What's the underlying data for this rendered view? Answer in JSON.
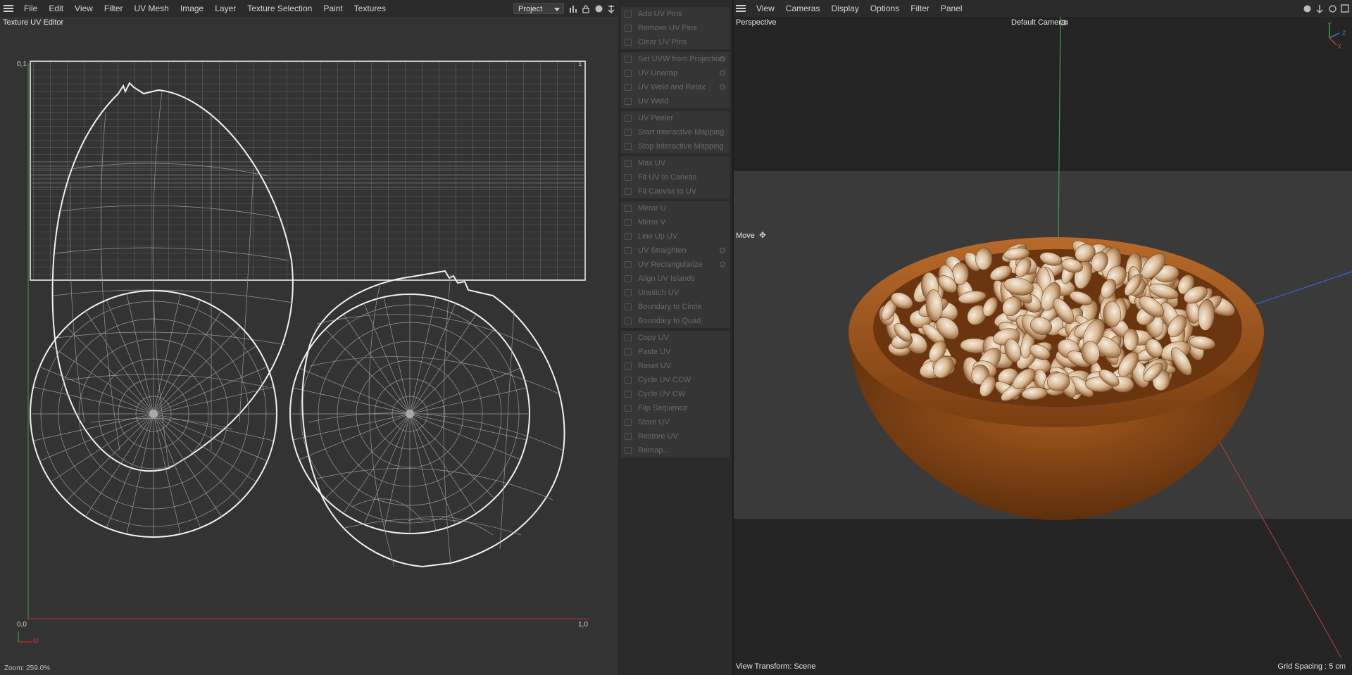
{
  "left_menu": {
    "items": [
      "File",
      "Edit",
      "View",
      "Filter",
      "UV Mesh",
      "Image",
      "Layer",
      "Texture Selection",
      "Paint",
      "Textures"
    ],
    "project_select": "Project"
  },
  "uv_editor": {
    "title": "Texture UV Editor",
    "corner_top_left": "0,1",
    "corner_top_right": "1",
    "origin": "0,0",
    "corner_bottom_right": "1,0",
    "u_label": "U",
    "zoom": "Zoom: 259.0%"
  },
  "commands": {
    "groups": [
      [
        {
          "label": "Add UV Pins",
          "gear": false
        },
        {
          "label": "Remove UV Pins",
          "gear": false
        },
        {
          "label": "Clear UV Pins",
          "gear": false
        }
      ],
      [
        {
          "label": "Set UVW from Projection",
          "gear": true
        },
        {
          "label": "UV Unwrap",
          "gear": true
        },
        {
          "label": "UV Weld and Relax",
          "gear": true
        },
        {
          "label": "UV Weld",
          "gear": false
        }
      ],
      [
        {
          "label": "UV Peeler",
          "gear": false
        },
        {
          "label": "Start Interactive Mapping",
          "gear": false
        },
        {
          "label": "Stop Interactive Mapping",
          "gear": false
        }
      ],
      [
        {
          "label": "Max UV",
          "gear": false
        },
        {
          "label": "Fit UV to Canvas",
          "gear": false
        },
        {
          "label": "Fit Canvas to UV",
          "gear": false
        }
      ],
      [
        {
          "label": "Mirror U",
          "gear": false
        },
        {
          "label": "Mirror V",
          "gear": false
        },
        {
          "label": "Line Up UV",
          "gear": false
        },
        {
          "label": "UV Straighten",
          "gear": true
        },
        {
          "label": "UV Rectangularize",
          "gear": true
        },
        {
          "label": "Align UV Islands",
          "gear": false
        },
        {
          "label": "Unstitch UV",
          "gear": false
        },
        {
          "label": "Boundary to Circle",
          "gear": false
        },
        {
          "label": "Boundary to Quad",
          "gear": false
        }
      ],
      [
        {
          "label": "Copy UV",
          "gear": false
        },
        {
          "label": "Paste UV",
          "gear": false
        },
        {
          "label": "Reset UV",
          "gear": false
        },
        {
          "label": "Cycle UV CCW",
          "gear": false
        },
        {
          "label": "Cycle UV CW",
          "gear": false
        },
        {
          "label": "Flip Sequence",
          "gear": false
        },
        {
          "label": "Store UV",
          "gear": false
        },
        {
          "label": "Restore UV",
          "gear": false
        },
        {
          "label": "Remap...",
          "gear": false
        }
      ]
    ]
  },
  "viewport": {
    "menu": [
      "View",
      "Cameras",
      "Display",
      "Options",
      "Filter",
      "Panel"
    ],
    "projection": "Perspective",
    "camera": "Default Camera",
    "tool": "Move",
    "view_transform": "View Transform: Scene",
    "grid_spacing": "Grid Spacing : 5 cm",
    "axis_y": "Y",
    "axis_z": "Z",
    "axis_x": "X"
  },
  "colors": {
    "axis_x": "#d04040",
    "axis_y": "#40c040",
    "axis_z": "#4070e0",
    "bowl": "#8a4a18"
  }
}
